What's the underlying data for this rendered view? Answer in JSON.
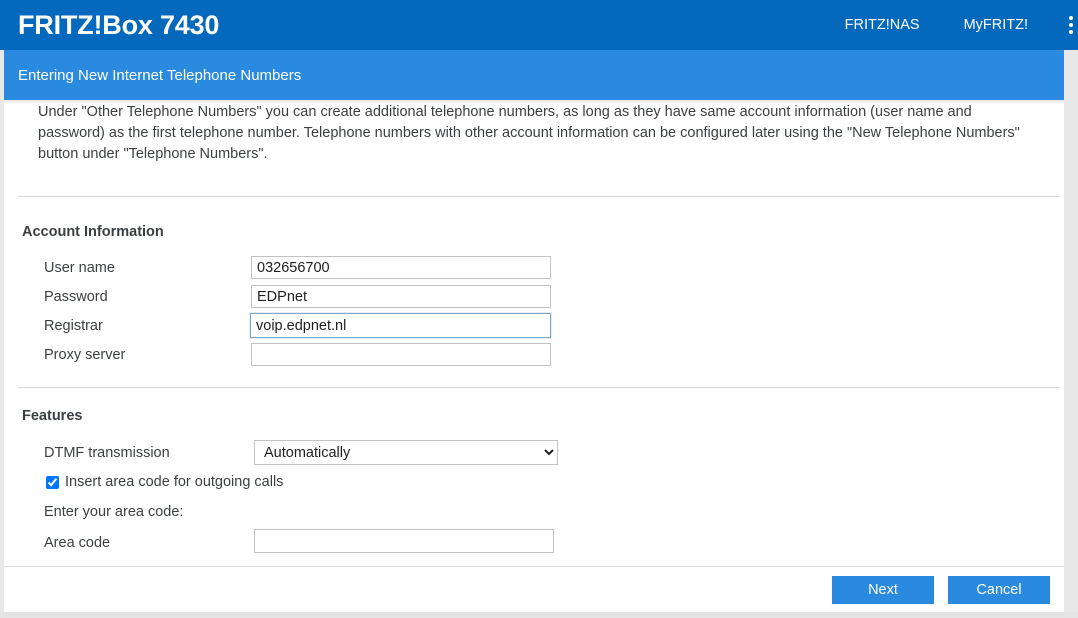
{
  "header": {
    "brand": "FRITZ!Box 7430",
    "nav": [
      {
        "label": "FRITZ!NAS"
      },
      {
        "label": "MyFRITZ!"
      }
    ],
    "menu_icon": "kebab-menu-icon"
  },
  "subheader": {
    "title": "Entering New Internet Telephone Numbers"
  },
  "content": {
    "intro": "Under \"Other Telephone Numbers\" you can create additional telephone numbers, as long as they have same account information (user name and password) as the first telephone number. Telephone numbers with other account information can be configured later using the \"New Telephone Numbers\" button under \"Telephone Numbers\".",
    "account_section": {
      "title": "Account Information",
      "fields": [
        {
          "label": "User name",
          "value": "032656700",
          "placeholder": "",
          "focused": false
        },
        {
          "label": "Password",
          "value": "EDPnet",
          "placeholder": "",
          "focused": false
        },
        {
          "label": "Registrar",
          "value": "voip.edpnet.nl",
          "placeholder": "",
          "focused": true
        },
        {
          "label": "Proxy server",
          "value": "",
          "placeholder": "",
          "focused": false
        }
      ]
    },
    "features_section": {
      "title": "Features",
      "dtmf_label": "DTMF transmission",
      "dtmf_value": "Automatically",
      "dtmf_options": [
        "Automatically"
      ],
      "area_code_checkbox_label": "Insert area code for outgoing calls",
      "area_code_checked": true,
      "area_code_note": "Enter your area code:",
      "area_code_label": "Area code",
      "area_code_value": "",
      "area_code_placeholder": ""
    }
  },
  "footer": {
    "next_label": "Next",
    "cancel_label": "Cancel"
  },
  "colors": {
    "header_blue": "#0468bd",
    "accent_blue": "#2a8ae0",
    "text": "#3c3f42",
    "field_border": "#c2c2c2",
    "focus_border": "#7fa8c4"
  }
}
